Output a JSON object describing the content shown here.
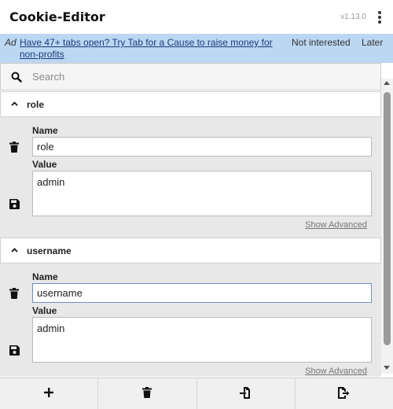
{
  "header": {
    "title": "Cookie-Editor",
    "version": "v1.13.0",
    "menu_icon": "kebab-menu-icon"
  },
  "ad": {
    "tag": "Ad",
    "link_text": "Have 47+ tabs open? Try Tab for a Cause to raise money for non-profits",
    "not_interested": "Not interested",
    "later": "Later",
    "background": "#bcd7f2"
  },
  "search": {
    "placeholder": "Search",
    "value": "",
    "icon": "search-icon"
  },
  "cookies": [
    {
      "name": "role",
      "name_label": "Name",
      "value_label": "Value",
      "name_value": "role",
      "value_value": "admin",
      "show_advanced": "Show Advanced"
    },
    {
      "name": "username",
      "name_label": "Name",
      "value_label": "Value",
      "name_value": "username",
      "value_value": "admin",
      "show_advanced": "Show Advanced"
    }
  ],
  "toolbar": {
    "items": [
      {
        "name": "add-cookie-button",
        "icon": "plus-icon"
      },
      {
        "name": "delete-all-button",
        "icon": "trash-icon"
      },
      {
        "name": "import-button",
        "icon": "import-icon"
      },
      {
        "name": "export-button",
        "icon": "export-icon"
      }
    ]
  },
  "colors": {
    "accent_focus": "#6b8fc9",
    "list_bg": "#e8e8e8"
  }
}
